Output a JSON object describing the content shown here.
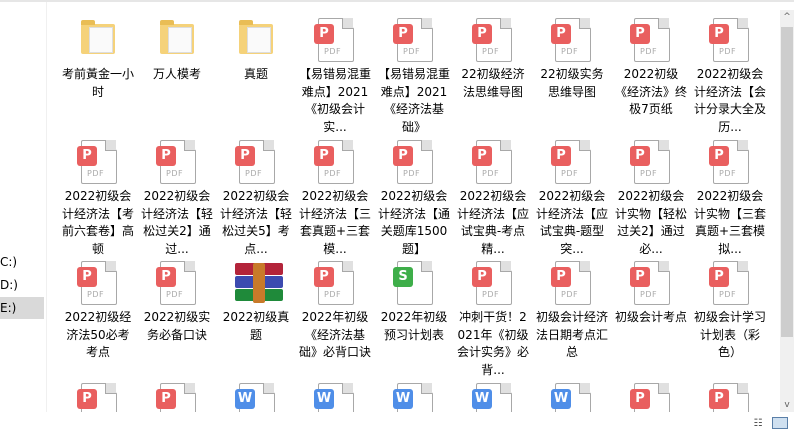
{
  "nav": {
    "drives": [
      {
        "label": "C:)",
        "selected": false
      },
      {
        "label": "D:)",
        "selected": false
      },
      {
        "label": "E:)",
        "selected": true
      }
    ]
  },
  "colors": {
    "pdf": "#e95f5f",
    "word": "#4f8ee8",
    "sheet": "#3eae49",
    "folder": "#f5d27a",
    "selected": "#d9d9d9"
  },
  "files": [
    {
      "name": "考前黃金一小时",
      "type": "folder"
    },
    {
      "name": "万人模考",
      "type": "folder"
    },
    {
      "name": "真题",
      "type": "folder"
    },
    {
      "name": "【易错易混重难点】2021《初级会计实...",
      "type": "pdf"
    },
    {
      "name": "【易错易混重难点】2021《经济法基础》",
      "type": "pdf"
    },
    {
      "name": "22初级经济法思维导图",
      "type": "pdf"
    },
    {
      "name": "22初级实务思维导图",
      "type": "pdf"
    },
    {
      "name": "2022初级《经济法》终极7页纸",
      "type": "pdf"
    },
    {
      "name": "2022初级会计经济法【会计分录大全及历...",
      "type": "pdf"
    },
    {
      "name": "2022初级会计经济法【考前六套卷】高顿",
      "type": "pdf"
    },
    {
      "name": "2022初级会计经济法【轻松过关2】通过...",
      "type": "pdf"
    },
    {
      "name": "2022初级会计经济法【轻松过关5】考点...",
      "type": "pdf"
    },
    {
      "name": "2022初级会计经济法【三套真题+三套模...",
      "type": "pdf"
    },
    {
      "name": "2022初级会计经济法【通关题库1500题】",
      "type": "pdf"
    },
    {
      "name": "2022初级会计经济法【应试宝典-考点精...",
      "type": "pdf"
    },
    {
      "name": "2022初级会计经济法【应试宝典-题型突...",
      "type": "pdf"
    },
    {
      "name": "2022初级会计实物【轻松过关2】通过必...",
      "type": "pdf"
    },
    {
      "name": "2022初级会计实物【三套真题+三套模拟...",
      "type": "pdf"
    },
    {
      "name": "2022初级经济法50必考考点",
      "type": "pdf"
    },
    {
      "name": "2022初级实务必备口诀",
      "type": "pdf"
    },
    {
      "name": "2022初级真题",
      "type": "rar"
    },
    {
      "name": "2022年初级《经济法基础》必背口诀",
      "type": "pdf"
    },
    {
      "name": "2022年初级预习计划表",
      "type": "sheet"
    },
    {
      "name": "冲刺干货！2021年《初级会计实务》必背...",
      "type": "pdf"
    },
    {
      "name": "初级会计经济法日期考点汇总",
      "type": "pdf"
    },
    {
      "name": "初级会计考点",
      "type": "pdf"
    },
    {
      "name": "初级会计学习计划表（彩色）",
      "type": "pdf"
    },
    {
      "name": "",
      "type": "pdf"
    },
    {
      "name": "",
      "type": "pdf"
    },
    {
      "name": "",
      "type": "word"
    },
    {
      "name": "",
      "type": "word"
    },
    {
      "name": "",
      "type": "word"
    },
    {
      "name": "",
      "type": "word"
    },
    {
      "name": "",
      "type": "word"
    },
    {
      "name": "",
      "type": "pdf"
    },
    {
      "name": "",
      "type": "pdf"
    }
  ],
  "icons": {
    "pdf_badge": "P",
    "pdf_text": "PDF",
    "word_badge": "W",
    "sheet_badge": "S",
    "scroll_up": "^",
    "scroll_down": "v",
    "details_view": "☷",
    "large_icons_view": "▭"
  }
}
